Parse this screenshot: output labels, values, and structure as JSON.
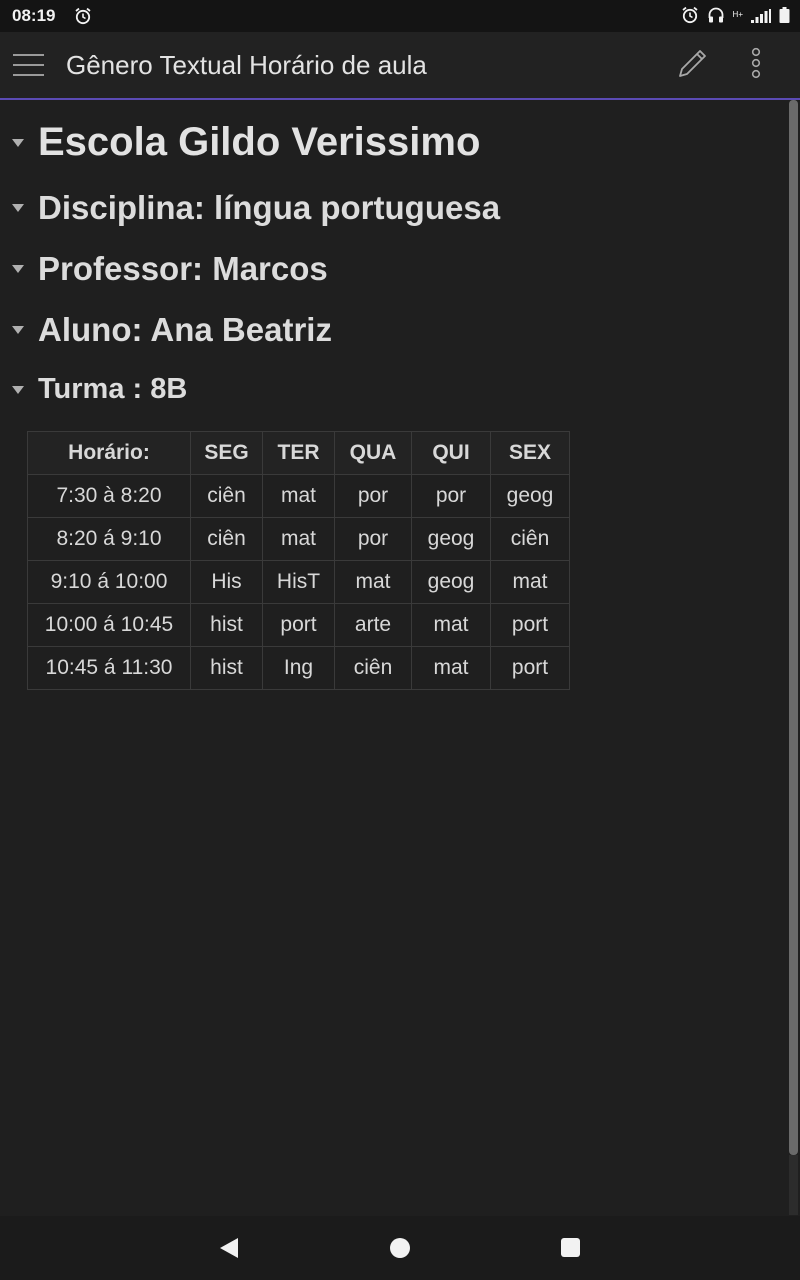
{
  "status_bar": {
    "time": "08:19",
    "icons": [
      "alarm-icon",
      "headphones-icon",
      "network-h-plus-icon",
      "signal-icon",
      "battery-icon"
    ],
    "network_label": "H+"
  },
  "app_bar": {
    "title": "Gênero Textual Horário de aula",
    "icons": [
      "menu-icon",
      "edit-pencil-icon",
      "more-vertical-icon"
    ]
  },
  "document": {
    "headings": [
      {
        "text": "Escola Gildo Verissimo",
        "level": 1
      },
      {
        "text": "Disciplina: língua portuguesa",
        "level": 2
      },
      {
        "text": "Professor: Marcos",
        "level": 2
      },
      {
        "text": "Aluno: Ana Beatriz",
        "level": 2
      },
      {
        "text": "Turma : 8B",
        "level": 3
      }
    ],
    "table": {
      "headers": [
        "Horário:",
        "SEG",
        "TER",
        "QUA",
        "QUI",
        "SEX"
      ],
      "rows": [
        [
          "7:30 à 8:20",
          "ciên",
          "mat",
          "por",
          "por",
          "geog"
        ],
        [
          "8:20 á 9:10",
          "ciên",
          "mat",
          "por",
          "geog",
          "ciên"
        ],
        [
          "9:10 á 10:00",
          "His",
          "HisT",
          "mat",
          "geog",
          "mat"
        ],
        [
          "10:00 á 10:45",
          "hist",
          "port",
          "arte",
          "mat",
          "port"
        ],
        [
          "10:45 á 11:30",
          "hist",
          "Ing",
          "ciên",
          "mat",
          "port"
        ]
      ]
    }
  },
  "nav_bar": {
    "icons": [
      "back-icon",
      "home-icon",
      "recents-icon"
    ]
  },
  "colors": {
    "background": "#1f1f1f",
    "app_bar": "#222222",
    "accent_line": "#5b4bb5",
    "text": "#dedede"
  }
}
